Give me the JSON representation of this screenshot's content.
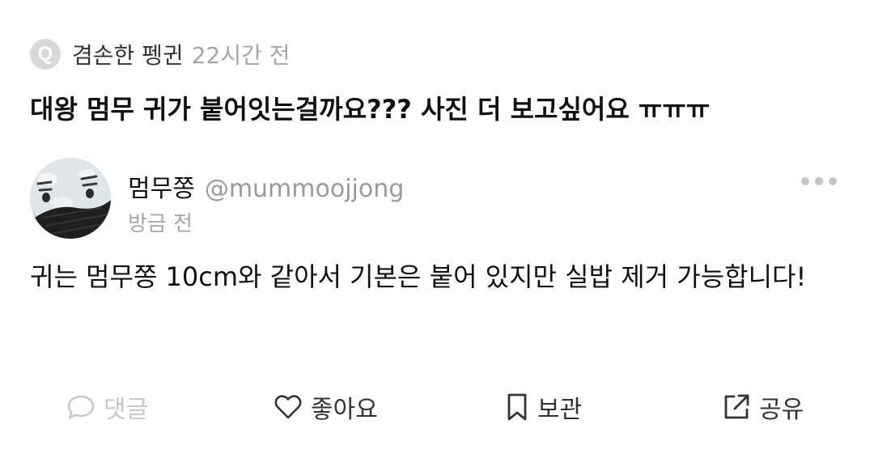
{
  "question": {
    "badge": "Q",
    "asker_name": "겸손한 펭귄",
    "time": "22시간 전",
    "text": "대왕 멈무 귀가 붙어잇는걸까요??? 사진 더 보고싶어요 ㅠㅠㅠ"
  },
  "reply": {
    "author_name": "멈무쫑",
    "handle": "@mummoojjong",
    "time": "방금 전",
    "text": "귀는 멈무쫑 10cm와 같아서 기본은 붙어 있지만 실밥 제거 가능합니다!"
  },
  "actions": {
    "comment_label": "댓글",
    "like_label": "좋아요",
    "save_label": "보관",
    "share_label": "공유"
  },
  "icons": {
    "more": "more-horizontal-icon",
    "comment": "speech-bubble-icon",
    "like": "heart-icon",
    "save": "bookmark-icon",
    "share": "share-external-icon"
  },
  "colors": {
    "muted": "#c8c8c8",
    "secondary_text": "#a6a6a6",
    "badge_bg": "#d8d8d8"
  }
}
